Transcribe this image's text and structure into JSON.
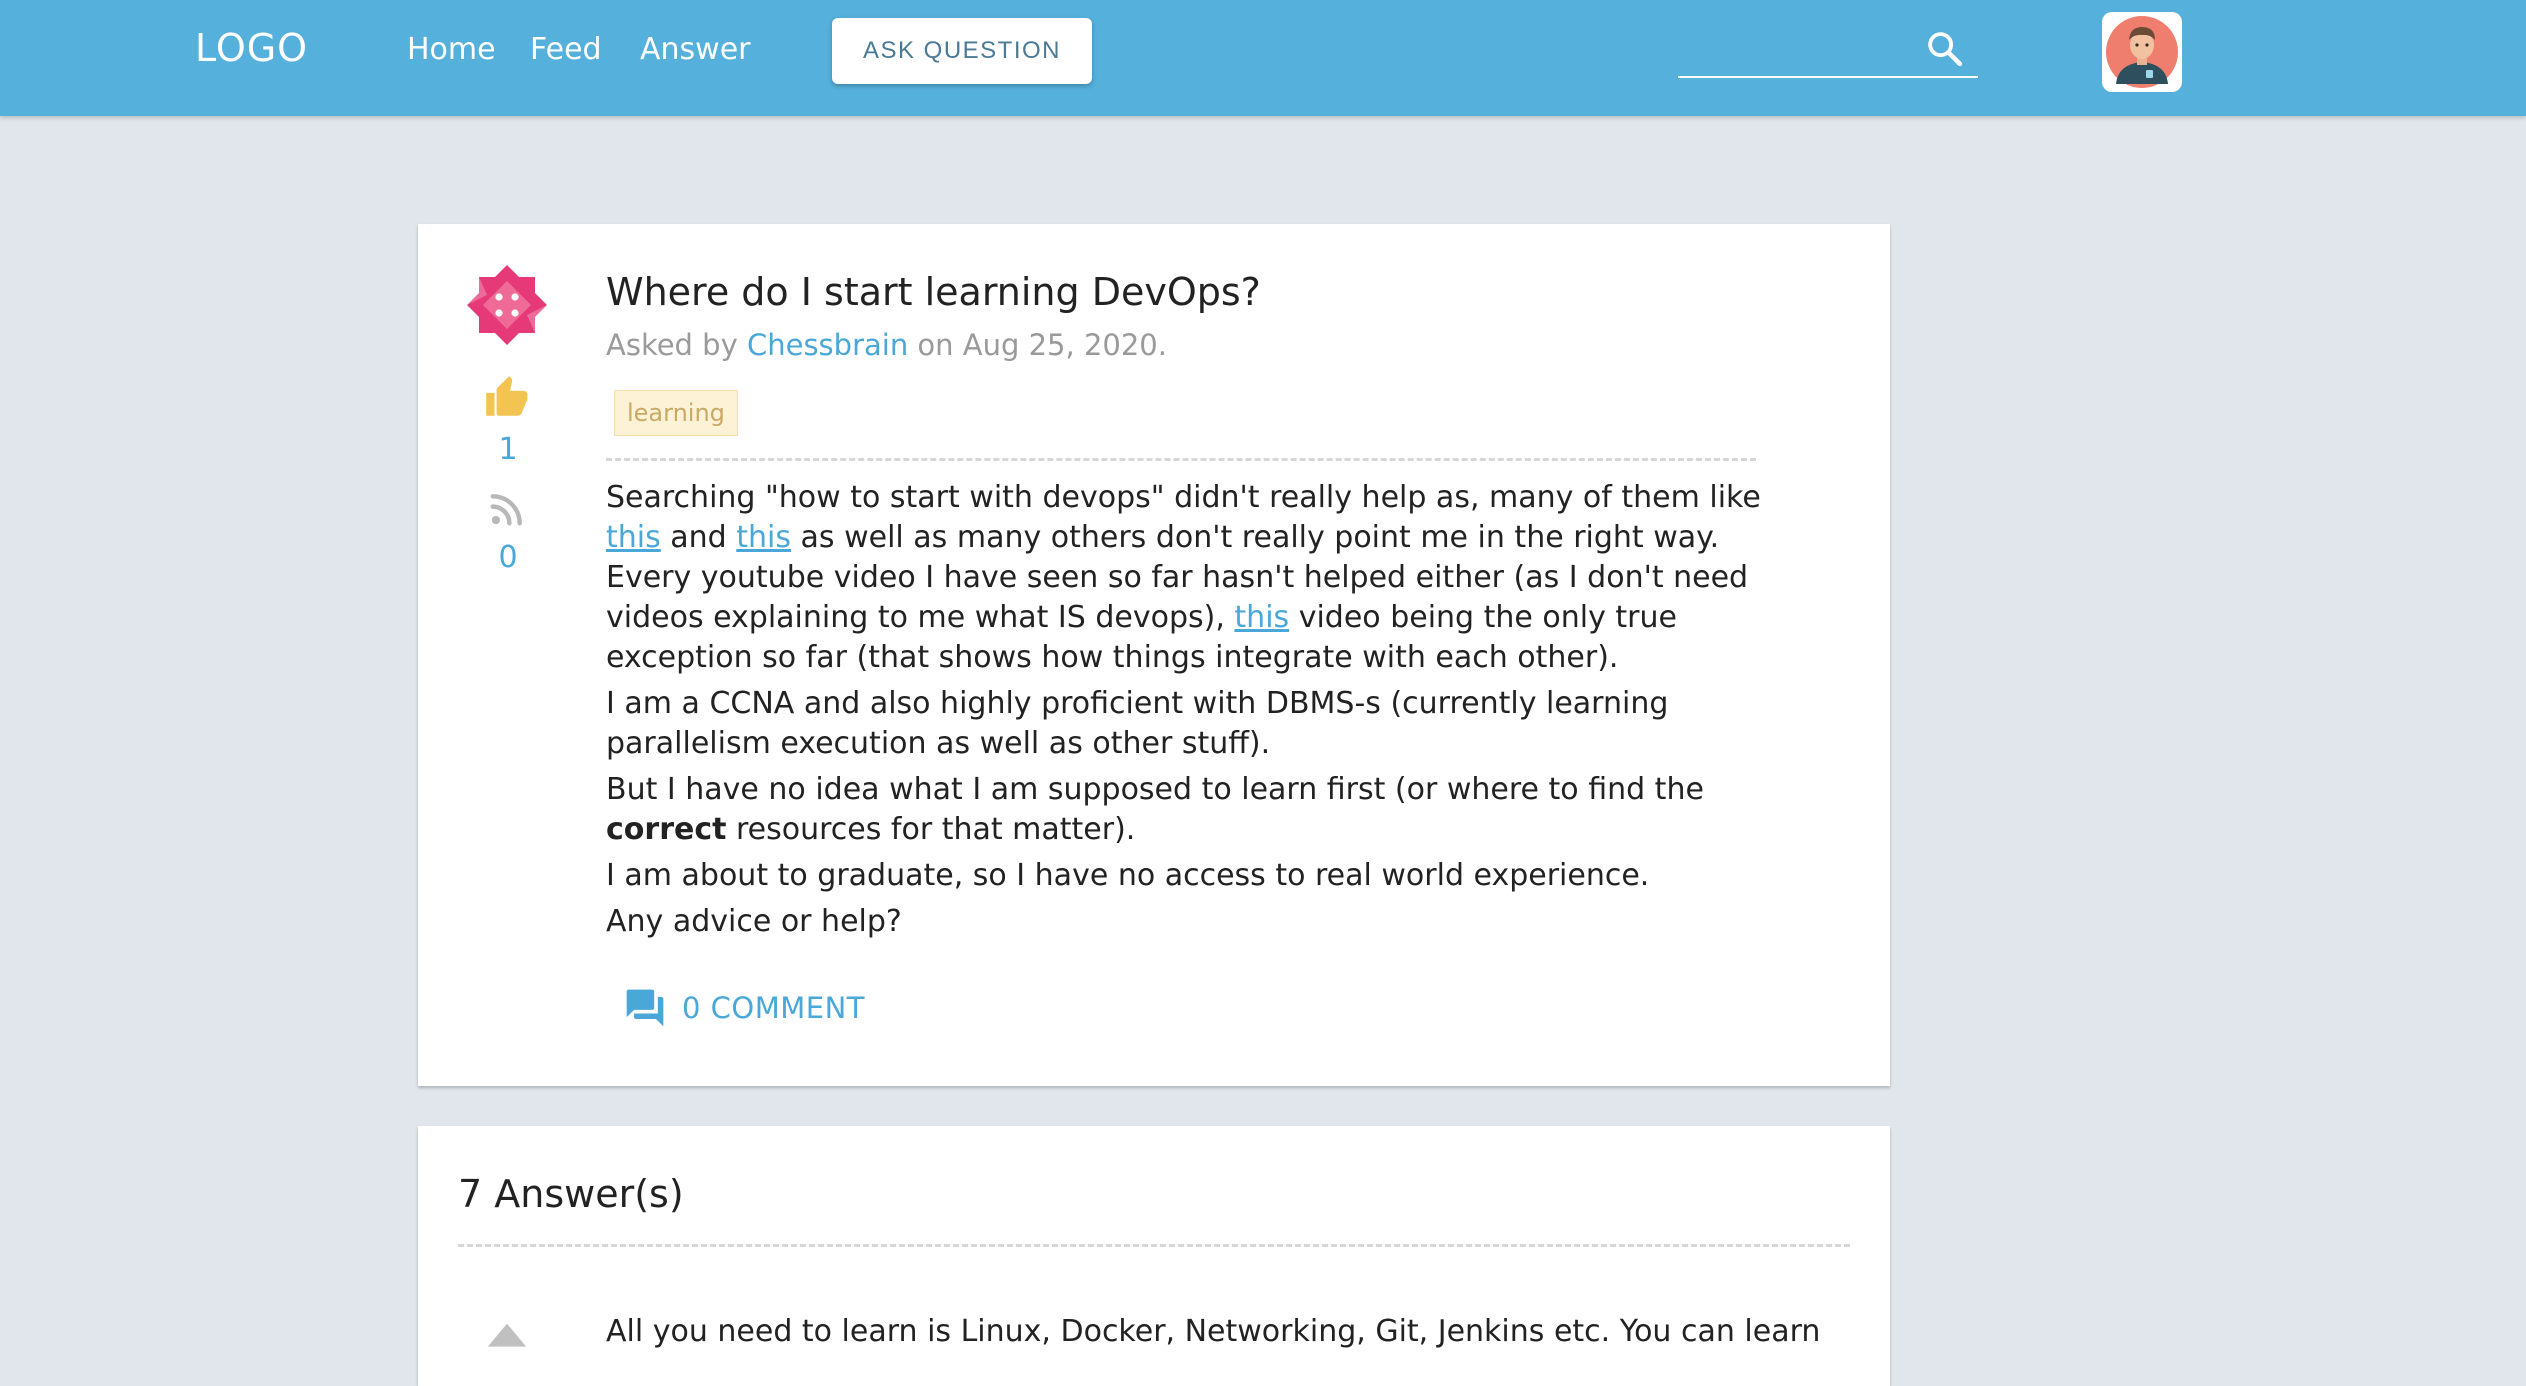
{
  "header": {
    "logo": "LOGO",
    "nav": [
      "Home",
      "Feed",
      "Answer"
    ],
    "ask_button": "ASK QUESTION",
    "search_placeholder": ""
  },
  "question": {
    "title": "Where do I start learning DevOps?",
    "asked_by_prefix": "Asked by ",
    "author": "Chessbrain",
    "date_text": " on Aug 25, 2020.",
    "tag": "learning",
    "votes": "1",
    "follows": "0",
    "body": {
      "p1_a": "Searching \"how to start with devops\" didn't really help as, many of them like ",
      "link1": "this",
      "p1_b": " and ",
      "link2": "this",
      "p1_c": " as well as many others don't really point me in the right way. Every youtube video I have seen so far hasn't helped either (as I don't need videos explaining to me what IS devops), ",
      "link3": "this",
      "p1_d": " video being the only true exception so far (that shows how things integrate with each other).",
      "p2": "I am a CCNA and also highly proficient with DBMS-s (currently learning parallelism execution as well as other stuff).",
      "p3_a": "But I have no idea what I am supposed to learn first (or where to find the ",
      "p3_bold": "correct",
      "p3_b": " resources for that matter).",
      "p4": "I am about to graduate, so I have no access to real world experience.",
      "p5": "Any advice or help?"
    },
    "comment_button": "0 COMMENT"
  },
  "answers": {
    "title": "7 Answer(s)",
    "first_answer_preview": "All you need to learn is Linux, Docker, Networking, Git, Jenkins etc. You can learn"
  },
  "colors": {
    "header_bg": "#56b0dc",
    "page_bg": "#e0e6ec",
    "accent": "#4aa8d8",
    "vote_icon": "#f3c452",
    "avatar_pink": "#e63a78"
  }
}
